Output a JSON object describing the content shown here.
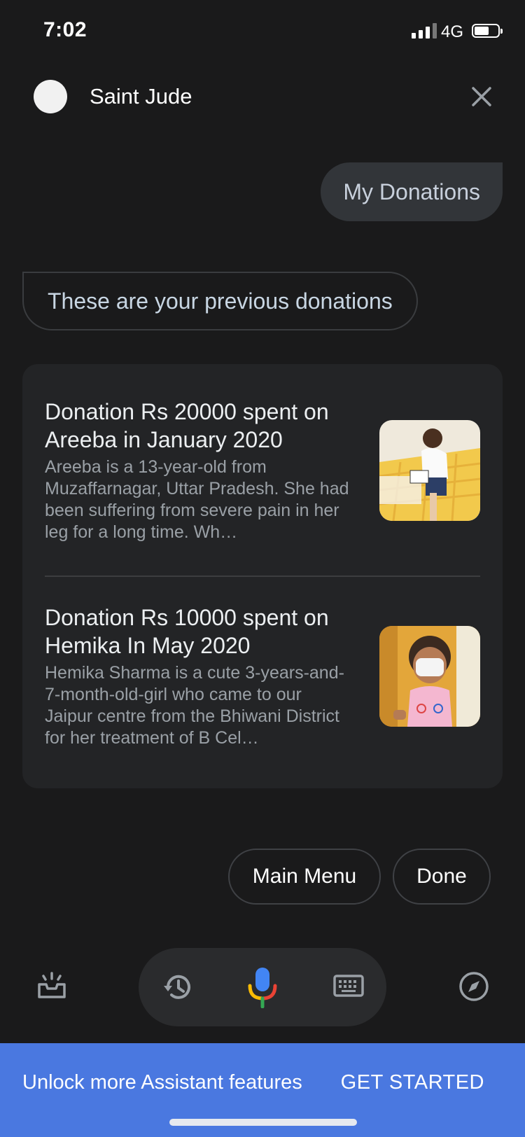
{
  "status_bar": {
    "time": "7:02",
    "network": "4G"
  },
  "header": {
    "agent_name": "Saint Jude"
  },
  "messages": {
    "user": "My Donations",
    "bot": "These are your previous donations"
  },
  "donations": [
    {
      "title": "Donation Rs 20000 spent on Areeba in January 2020",
      "description": "Areeba is a 13-year-old from Muzaffarnagar, Uttar Pradesh. She had been suffering from severe pain in her leg for a long time. Wh…"
    },
    {
      "title": "Donation Rs 10000 spent on Hemika In May 2020",
      "description": "Hemika Sharma is a cute 3-years-and-7-month-old-girl who came to our Jaipur centre from the Bhiwani District for her treatment of B Cel…"
    }
  ],
  "chips": {
    "main_menu": "Main Menu",
    "done": "Done"
  },
  "banner": {
    "text": "Unlock more Assistant features",
    "cta": "GET STARTED"
  },
  "icons": {
    "updates": "inbox-tray-icon",
    "history": "history-icon",
    "mic": "microphone-icon",
    "keyboard": "keyboard-icon",
    "explore": "compass-icon",
    "close": "close-icon"
  },
  "colors": {
    "background": "#1a1a1b",
    "banner": "#4a78e0",
    "card": "#232426"
  }
}
